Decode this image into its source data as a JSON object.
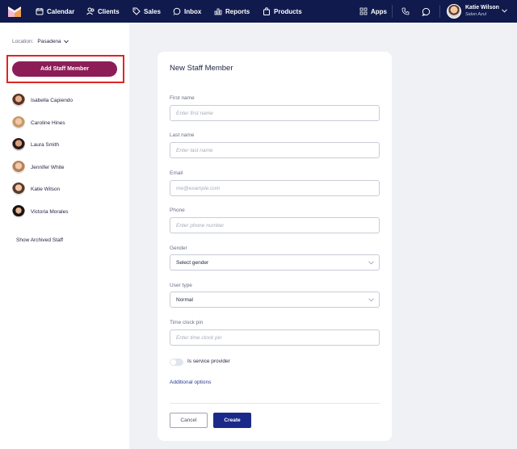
{
  "nav": {
    "items": [
      {
        "label": "Calendar",
        "icon": "calendar-icon"
      },
      {
        "label": "Clients",
        "icon": "clients-icon"
      },
      {
        "label": "Sales",
        "icon": "tag-icon"
      },
      {
        "label": "Inbox",
        "icon": "inbox-icon"
      },
      {
        "label": "Reports",
        "icon": "bar-chart-icon"
      },
      {
        "label": "Products",
        "icon": "bag-icon"
      }
    ],
    "apps_label": "Apps",
    "user": {
      "name": "Katie Wilson",
      "business": "Salon Azul"
    }
  },
  "sidebar": {
    "location_label": "Location:",
    "location_value": "Pasadena",
    "add_button": "Add Staff Member",
    "staff": [
      "Isabella Capiendo",
      "Caroline Hines",
      "Laura Smith",
      "Jennifer White",
      "Katie Wilson",
      "Victoria Morales"
    ],
    "archived_link": "Show Archived Staff"
  },
  "form": {
    "title": "New Staff Member",
    "first_name": {
      "label": "First name",
      "placeholder": "Enter first name"
    },
    "last_name": {
      "label": "Last name",
      "placeholder": "Enter last name"
    },
    "email": {
      "label": "Email",
      "placeholder": "me@example.com"
    },
    "phone": {
      "label": "Phone",
      "placeholder": "Enter phone number"
    },
    "gender": {
      "label": "Gender",
      "value": "Select gender"
    },
    "user_type": {
      "label": "User type",
      "value": "Normal"
    },
    "pin": {
      "label": "Time clock pin",
      "placeholder": "Enter time clock pin"
    },
    "service_provider_label": "Is service provider",
    "additional_options": "Additional options",
    "cancel_label": "Cancel",
    "create_label": "Create"
  },
  "colors": {
    "nav_bg": "#101a4d",
    "accent_button": "#8c1d57",
    "create_button": "#1b2a8a",
    "highlight": "#e02424"
  }
}
